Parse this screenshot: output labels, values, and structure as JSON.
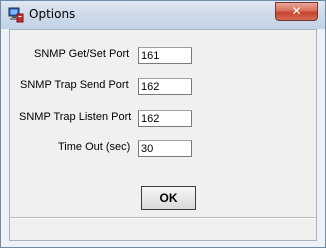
{
  "window": {
    "title": "Options",
    "close_symbol": "✕",
    "app_icon": "network-computer-icon"
  },
  "fields": [
    {
      "label": "SNMP Get/Set Port",
      "value": "161"
    },
    {
      "label": "SNMP Trap Send Port",
      "value": "162"
    },
    {
      "label": "SNMP Trap Listen Port",
      "value": "162"
    },
    {
      "label": "Time Out (sec)",
      "value": "30"
    }
  ],
  "buttons": {
    "ok_label": "OK"
  }
}
